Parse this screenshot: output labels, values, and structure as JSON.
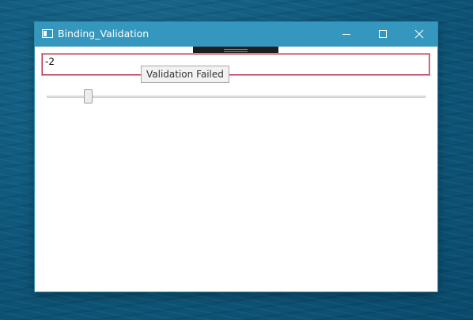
{
  "window": {
    "title": "Binding_Validation"
  },
  "titlebar": {
    "app_icon": "window-icon",
    "minimize_icon": "minimize-icon",
    "maximize_icon": "maximize-icon",
    "close_icon": "close-icon"
  },
  "textbox": {
    "value": "-2",
    "error_color": "#b8324e"
  },
  "tooltip": {
    "text": "Validation Failed"
  },
  "slider": {
    "value_fraction": 0.1
  },
  "colors": {
    "titlebar": "#3597be",
    "content": "#ffffff"
  }
}
